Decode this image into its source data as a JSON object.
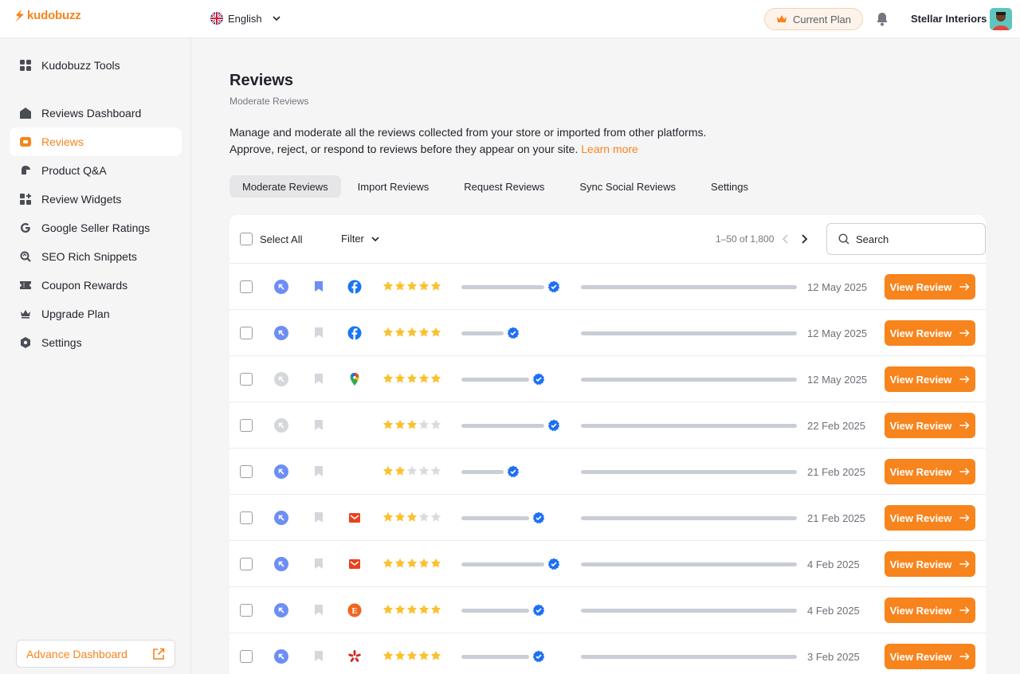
{
  "brand": {
    "name": "kudobuzz",
    "color": "#f7841c"
  },
  "header": {
    "language": "English",
    "plan_label": "Current Plan",
    "account_name": "Stellar Interiors"
  },
  "sidebar": {
    "items": [
      {
        "label": "Kudobuzz Tools",
        "icon": "grid-icon"
      },
      {
        "label": "Reviews Dashboard",
        "icon": "home-icon"
      },
      {
        "label": "Reviews",
        "icon": "review-icon",
        "active": true
      },
      {
        "label": "Product Q&A",
        "icon": "qa-icon"
      },
      {
        "label": "Review Widgets",
        "icon": "widgets-icon"
      },
      {
        "label": "Google Seller Ratings",
        "icon": "google-icon"
      },
      {
        "label": "SEO Rich Snippets",
        "icon": "seo-icon"
      },
      {
        "label": "Coupon Rewards",
        "icon": "coupon-icon"
      },
      {
        "label": "Upgrade Plan",
        "icon": "crown-icon"
      },
      {
        "label": "Settings",
        "icon": "gear-icon"
      }
    ],
    "advance_dashboard": "Advance Dashboard"
  },
  "page": {
    "title": "Reviews",
    "subtitle": "Moderate Reviews",
    "description_line1": "Manage and moderate all the reviews collected from your store or imported from other platforms.",
    "description_line2": "Approve, reject, or respond to reviews before they appear on your site.",
    "learn_more": "Learn more"
  },
  "tabs": [
    {
      "label": "Moderate Reviews",
      "active": true
    },
    {
      "label": "Import Reviews"
    },
    {
      "label": "Request Reviews"
    },
    {
      "label": "Sync Social Reviews"
    },
    {
      "label": "Settings"
    }
  ],
  "toolbar": {
    "select_all": "Select All",
    "filter": "Filter",
    "pagination": "1–50 of 1,800",
    "search_placeholder": "Search"
  },
  "view_review_label": "View Review",
  "reviews": [
    {
      "replied": true,
      "bookmarked": true,
      "source": "facebook-icon",
      "rating": 5,
      "date": "12 May 2025"
    },
    {
      "replied": true,
      "bookmarked": false,
      "source": "facebook-icon",
      "rating": 5,
      "date": "12 May 2025"
    },
    {
      "replied": false,
      "bookmarked": false,
      "source": "google-maps-icon",
      "rating": 5,
      "date": "12 May 2025"
    },
    {
      "replied": false,
      "bookmarked": false,
      "source": "",
      "rating": 3,
      "date": "22 Feb 2025"
    },
    {
      "replied": true,
      "bookmarked": false,
      "source": "",
      "rating": 2,
      "date": "21 Feb 2025"
    },
    {
      "replied": true,
      "bookmarked": false,
      "source": "email-icon",
      "rating": 3,
      "date": "21 Feb 2025"
    },
    {
      "replied": true,
      "bookmarked": false,
      "source": "email-icon",
      "rating": 5,
      "date": "4 Feb 2025"
    },
    {
      "replied": true,
      "bookmarked": false,
      "source": "etsy-icon",
      "rating": 5,
      "date": "4 Feb 2025"
    },
    {
      "replied": true,
      "bookmarked": false,
      "source": "yelp-icon",
      "rating": 5,
      "date": "3 Feb 2025"
    }
  ],
  "colors": {
    "accent": "#f7841c",
    "reply_active": "#6c8ef5",
    "verified": "#1e6ff5",
    "star": "#fbc02d",
    "star_empty": "#d8dbe0"
  }
}
